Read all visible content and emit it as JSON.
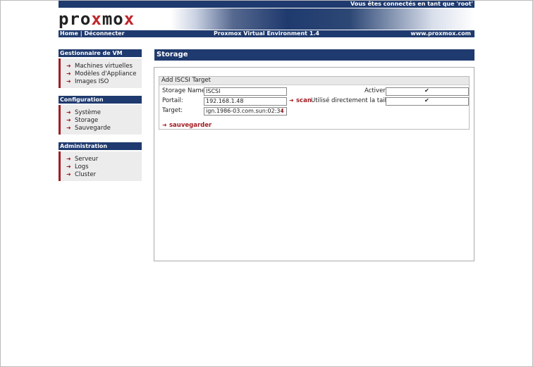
{
  "header": {
    "login_status": "Vous êtes connectés en tant que 'root'",
    "logo_text": "proxmox"
  },
  "nav": {
    "home": "Home",
    "sep": "|",
    "logout": "Déconnecter",
    "title": "Proxmox Virtual Environment 1.4",
    "site": "www.proxmox.com"
  },
  "sidebar": {
    "vm": {
      "title": "Gestionnaire de VM",
      "items": [
        "Machines virtuelles",
        "Modèles d'Appliance",
        "Images ISO"
      ]
    },
    "config": {
      "title": "Configuration",
      "items": [
        "Système",
        "Storage",
        "Sauvegarde"
      ]
    },
    "admin": {
      "title": "Administration",
      "items": [
        "Serveur",
        "Logs",
        "Cluster"
      ]
    }
  },
  "main": {
    "title": "Storage",
    "form": {
      "legend": "Add ISCSI Target",
      "storage_name_label": "Storage Name:",
      "storage_name_value": "ISCSI",
      "portal_label": "Portail:",
      "portal_value": "192.168.1.48",
      "target_label": "Target:",
      "target_value": "ign.1986-03.com.sun:02:34",
      "scan_label": "scan",
      "activer_label": "Activer:",
      "activer_checked": true,
      "direct_label": "Utilisé directement la taille :",
      "direct_checked": true,
      "save_label": "sauvegarder"
    }
  },
  "colors": {
    "navy": "#1f3a6e",
    "accent_red": "#a11c22"
  },
  "icons": {
    "arrow": "right-arrow-icon",
    "dropdown": "down-arrow-icon",
    "check": "checkmark-icon"
  }
}
